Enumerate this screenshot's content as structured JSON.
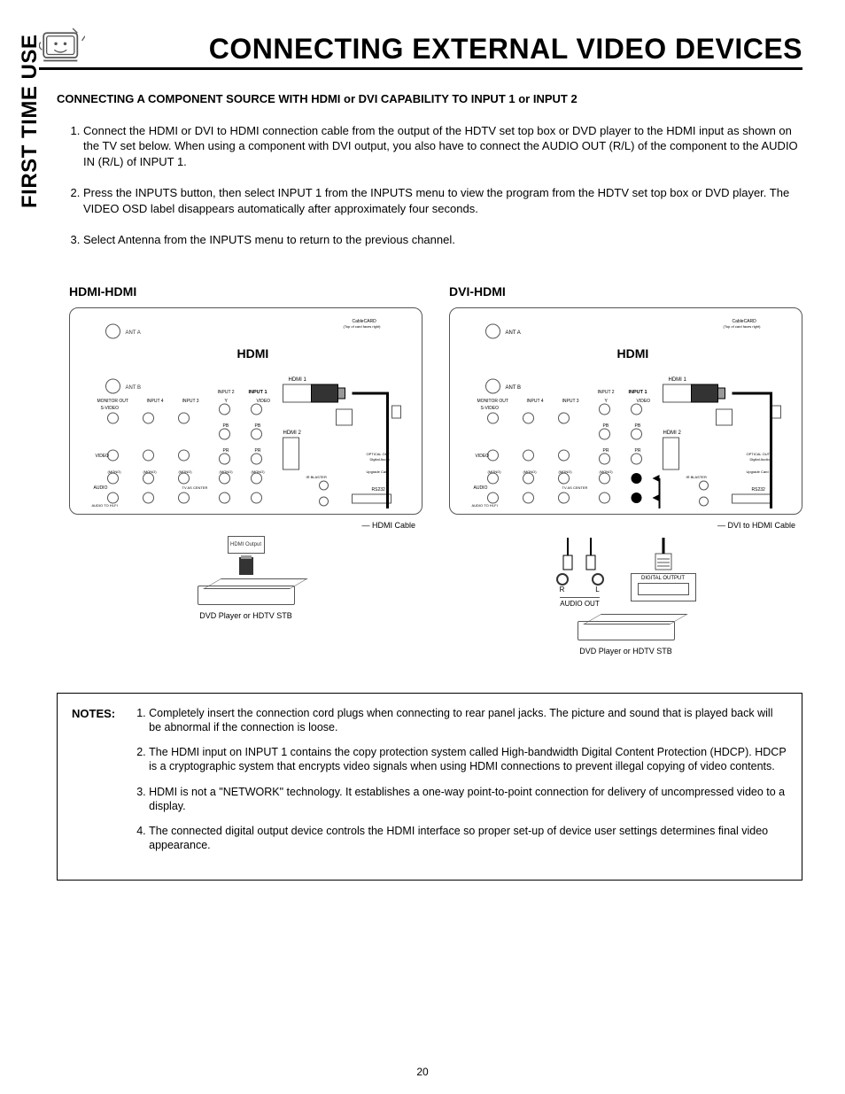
{
  "header": {
    "title": "CONNECTING EXTERNAL VIDEO DEVICES"
  },
  "side_label": "FIRST TIME USE",
  "section": {
    "heading": "CONNECTING A COMPONENT SOURCE WITH HDMI or DVI CAPABILITY TO INPUT 1 or INPUT 2",
    "steps": [
      "Connect the HDMI or DVI to HDMI connection cable from the output of the HDTV set top box or DVD player to the HDMI input as shown on the TV set below.  When using a component with DVI output, you also have to connect the AUDIO OUT (R/L) of the component to the AUDIO IN (R/L) of INPUT 1.",
      "Press the INPUTS button, then select INPUT 1 from the INPUTS menu to view the program from the HDTV set top box or DVD player.  The VIDEO OSD label disappears automatically after approximately four seconds.",
      "Select Antenna from the INPUTS menu to return to the previous channel."
    ]
  },
  "diagrams": {
    "left": {
      "title": "HDMI-HDMI",
      "cable_label": "HDMI Cable",
      "port_label": "HDMI Output",
      "device_label": "DVD Player or HDTV STB",
      "panel": {
        "ant_a": "ANT A",
        "ant_b": "ANT B",
        "hdmi_logo": "HDMI",
        "hdmi1": "HDMI 1",
        "hdmi2": "HDMI 2",
        "input1": "INPUT 1",
        "input2": "INPUT 2",
        "input3": "INPUT 3",
        "input4": "INPUT 4",
        "monitor_out": "MONITOR OUT",
        "svideo": "S-VIDEO",
        "video": "VIDEO",
        "audio": "AUDIO",
        "mono": "(MONO)",
        "ypbpr_y": "Y",
        "ypbpr_pb": "PB",
        "ypbpr_pr": "PR",
        "tv_as_center": "TV AS CENTER",
        "optical_out": "OPTICAL OUT Digital Audio",
        "upgrade": "Upgrade Card",
        "ir_blaster": "IR BLASTER",
        "rs232": "RS232",
        "cablecard": "CableCARD (Top of card faces right)",
        "audio_to_hifi": "AUDIO TO HI-FI"
      }
    },
    "right": {
      "title": "DVI-HDMI",
      "cable_label": "DVI to HDMI Cable",
      "device_label": "DVD Player or HDTV STB",
      "audio_out": "AUDIO OUT",
      "audio_r": "R",
      "audio_l": "L",
      "digital_output": "DIGITAL OUTPUT",
      "panel": {
        "ant_a": "ANT A",
        "ant_b": "ANT B",
        "hdmi_logo": "HDMI",
        "hdmi1": "HDMI 1",
        "hdmi2": "HDMI 2",
        "input1": "INPUT 1",
        "input2": "INPUT 2",
        "input3": "INPUT 3",
        "input4": "INPUT 4",
        "monitor_out": "MONITOR OUT",
        "svideo": "S-VIDEO",
        "video": "VIDEO",
        "audio": "AUDIO",
        "mono": "(MONO)",
        "ypbpr_y": "Y",
        "ypbpr_pb": "PB",
        "ypbpr_pr": "PR",
        "tv_as_center": "TV AS CENTER",
        "optical_out": "OPTICAL OUT Digital Audio",
        "upgrade": "Upgrade Card",
        "ir_blaster": "IR BLASTER",
        "rs232": "RS232",
        "cablecard": "CableCARD (Top of card faces right)",
        "audio_to_hifi": "AUDIO TO HI-FI"
      }
    }
  },
  "notes": {
    "label": "NOTES:",
    "items": [
      "Completely insert the connection cord plugs when connecting to rear panel jacks.  The picture and sound that is played back will be abnormal if the connection is loose.",
      "The HDMI input on INPUT 1 contains the copy protection system called High-bandwidth Digital Content Protection (HDCP).  HDCP is a cryptographic system that encrypts video signals when using HDMI connections to prevent illegal copying of video contents.",
      "HDMI is not a \"NETWORK\" technology.  It establishes a one-way point-to-point connection for delivery of uncompressed video to a display.",
      "The connected digital output device controls the HDMI interface so proper set-up of device user settings determines final video appearance."
    ]
  },
  "page_number": "20"
}
